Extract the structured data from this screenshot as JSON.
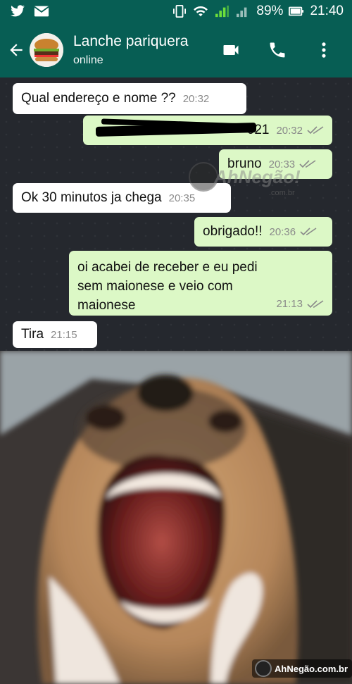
{
  "status_bar": {
    "left_icons": [
      "twitter-icon",
      "mail-icon"
    ],
    "right_icons": [
      "vibrate-icon",
      "wifi-icon",
      "signal-icon",
      "signal-icon-2",
      "battery-icon"
    ],
    "battery": "89%",
    "time": "21:40"
  },
  "header": {
    "name": "Lanche pariquera",
    "status": "online",
    "icons": [
      "back-arrow-icon",
      "burger-avatar",
      "video-call-icon",
      "phone-icon",
      "more-vert-icon"
    ],
    "accent": "#075e54"
  },
  "messages": [
    {
      "dir": "in",
      "text": "Qual endereço e nome ??",
      "time": "20:32"
    },
    {
      "dir": "out",
      "text": "021",
      "time": "20:32",
      "redacted": true
    },
    {
      "dir": "out",
      "text": "bruno",
      "time": "20:33"
    },
    {
      "dir": "in",
      "text": "Ok 30 minutos ja chega",
      "time": "20:35"
    },
    {
      "dir": "out",
      "text": "obrigado!!",
      "time": "20:36"
    },
    {
      "dir": "out",
      "text": "oi acabei de receber e eu pedi sem maionese e veio com maionese",
      "time": "21:13"
    },
    {
      "dir": "in",
      "text": "Tira",
      "time": "21:15"
    }
  ],
  "colors": {
    "incoming_bubble": "#ffffff",
    "outgoing_bubble": "#dcf8c6",
    "chat_background": "#25282e",
    "ticks": "#8a8a8a"
  },
  "watermarks": {
    "chat": "AhNegão!",
    "chat_sub": ".com.br",
    "photo": "AhNegão.com.br"
  },
  "photo": {
    "subject": "dog-yawning-photo"
  }
}
